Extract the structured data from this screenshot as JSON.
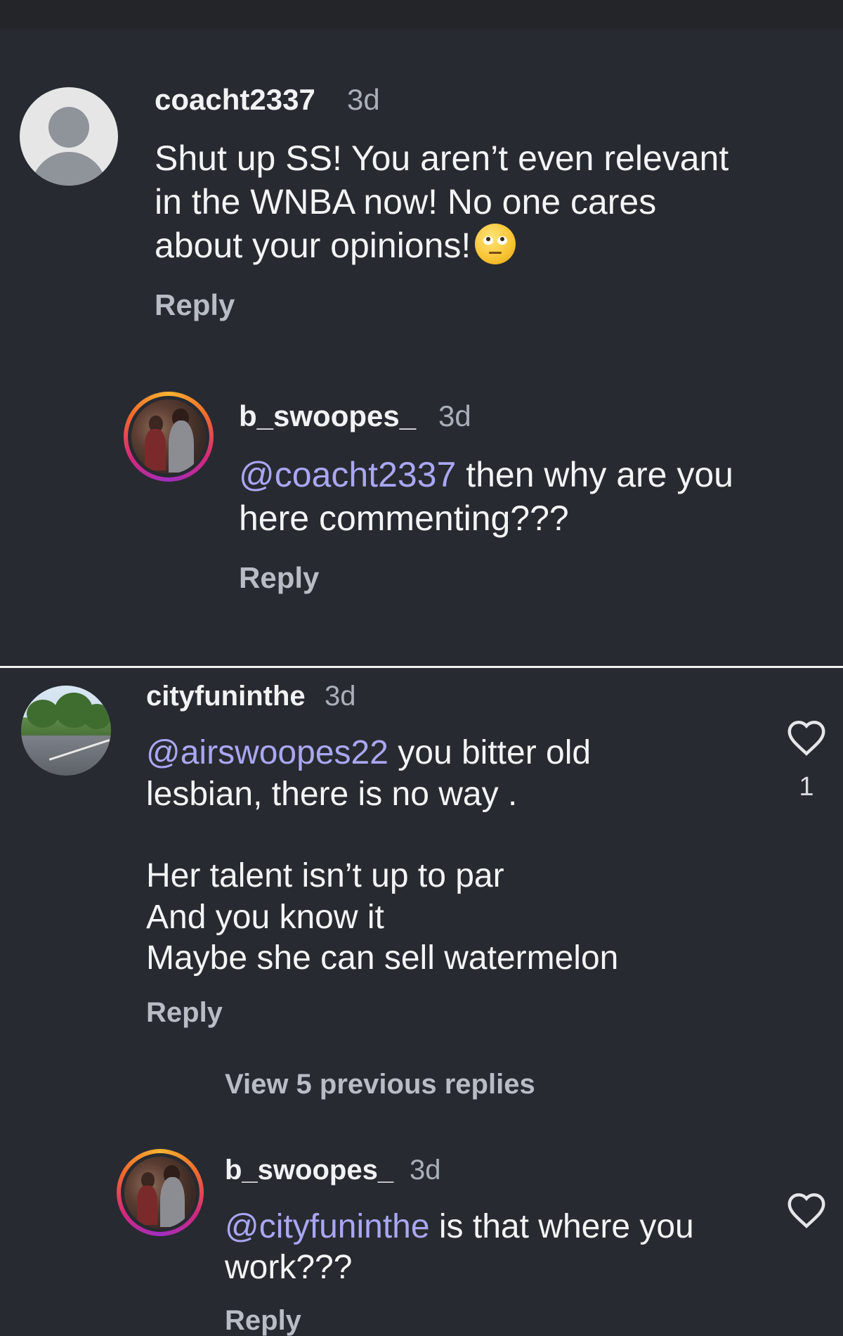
{
  "comments": [
    {
      "username": "coacht2337",
      "time": "3d",
      "text_lines": [
        "Shut up SS!  You aren’t even relevant",
        "in the WNBA now!  No one cares",
        "about your opinions!"
      ],
      "emoji": "face-with-rolling-eyes",
      "reply_label": "Reply"
    },
    {
      "username": "b_swoopes_",
      "time": "3d",
      "mention": "@coacht2337",
      "text_after_mention": " then why are you",
      "text_line2": "here commenting???",
      "reply_label": "Reply"
    },
    {
      "username": "cityfuninthe",
      "time": "3d",
      "mention": "@airswoopes22",
      "text_after_mention": "  you bitter old",
      "text_line2": "lesbian,  there is no way .",
      "text_lines_more": [
        "Her talent isn’t up to par",
        "And you know it",
        "Maybe she can sell watermelon"
      ],
      "reply_label": "Reply",
      "like_count": "1"
    },
    {
      "username": "b_swoopes_",
      "time": "3d",
      "mention": "@cityfuninthe",
      "text_after_mention": " is that where you",
      "text_line2": "work???",
      "reply_label": "Reply"
    }
  ],
  "view_previous_replies": "View 5 previous replies",
  "icons": {
    "default_avatar": "default-avatar-icon",
    "heart": "heart-outline-icon",
    "emoji": "face-with-rolling-eyes-emoji"
  },
  "colors": {
    "background": "#272a30",
    "mention": "#a9a7f4",
    "story_ring": [
      "#f9b331",
      "#f26a2b",
      "#d3287c",
      "#a02ec1"
    ]
  }
}
